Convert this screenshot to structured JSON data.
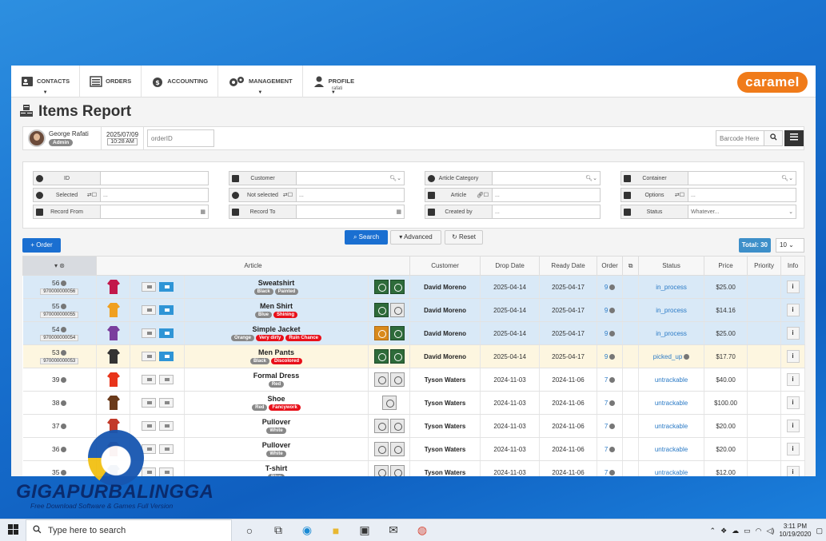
{
  "nav": {
    "items": [
      {
        "label": "CONTACTS",
        "icon": "contact-card-icon"
      },
      {
        "label": "ORDERS",
        "icon": "list-icon"
      },
      {
        "label": "ACCOUNTING",
        "icon": "money-bag-icon"
      },
      {
        "label": "MANAGEMENT",
        "icon": "gears-icon"
      },
      {
        "label": "PROFILE",
        "icon": "user-icon",
        "sub": "rafati"
      }
    ],
    "logo": "caramel"
  },
  "page": {
    "title": "Items Report"
  },
  "userbar": {
    "name": "George Rafati",
    "role": "Admin",
    "date": "2025/07/09",
    "time": "10:28 AM",
    "orderid_placeholder": "orderID",
    "barcode_placeholder": "Barcode Here"
  },
  "filters": {
    "id": "ID",
    "customer": "Customer",
    "article_category": "Article Category",
    "container": "Container",
    "selected": "Selected",
    "not_selected": "Not selected",
    "article": "Article",
    "options": "Options",
    "record_from": "Record From",
    "record_to": "Record To",
    "created_by": "Created by",
    "status": "Status",
    "status_value": "Whatever...",
    "search_hint": "..."
  },
  "actions": {
    "order": "Order",
    "search": "Search",
    "advanced": "Advanced",
    "reset": "Reset",
    "total": "Total: 30",
    "page_size": "10"
  },
  "table": {
    "headers": {
      "article": "Article",
      "customer": "Customer",
      "drop_date": "Drop Date",
      "ready_date": "Ready Date",
      "order": "Order",
      "status": "Status",
      "price": "Price",
      "priority": "Priority",
      "info": "Info"
    },
    "rows": [
      {
        "id": "56",
        "barcode": "970000000056",
        "name": "Sweatshirt",
        "tags": [
          {
            "t": "Black",
            "c": "gray"
          },
          {
            "t": "Painted",
            "c": "gray"
          }
        ],
        "customer": "David Moreno",
        "drop": "2025-04-14",
        "ready": "2025-04-17",
        "order": "9",
        "status": "in_process",
        "price": "$25.00",
        "state": "sel"
      },
      {
        "id": "55",
        "barcode": "970000000055",
        "name": "Men Shirt",
        "tags": [
          {
            "t": "Blue",
            "c": "gray"
          },
          {
            "t": "Shining",
            "c": "red"
          }
        ],
        "customer": "David Moreno",
        "drop": "2025-04-14",
        "ready": "2025-04-17",
        "order": "9",
        "status": "in_process",
        "price": "$14.16",
        "state": "sel"
      },
      {
        "id": "54",
        "barcode": "970000000054",
        "name": "Simple Jacket",
        "tags": [
          {
            "t": "Orange",
            "c": "gray"
          },
          {
            "t": "Very dirty",
            "c": "red"
          },
          {
            "t": "Ruin Chance",
            "c": "red"
          }
        ],
        "customer": "David Moreno",
        "drop": "2025-04-14",
        "ready": "2025-04-17",
        "order": "9",
        "status": "in_process",
        "price": "$25.00",
        "state": "sel"
      },
      {
        "id": "53",
        "barcode": "970000000053",
        "name": "Men Pants",
        "tags": [
          {
            "t": "Black",
            "c": "gray"
          },
          {
            "t": "Discolored",
            "c": "red"
          }
        ],
        "customer": "David Moreno",
        "drop": "2025-04-14",
        "ready": "2025-04-17",
        "order": "9",
        "status": "picked_up",
        "price": "$17.70",
        "state": "pick"
      },
      {
        "id": "39",
        "barcode": "",
        "name": "Formal Dress",
        "tags": [
          {
            "t": "Red",
            "c": "gray"
          }
        ],
        "customer": "Tyson Waters",
        "drop": "2024-11-03",
        "ready": "2024-11-06",
        "order": "7",
        "status": "untrackable",
        "price": "$40.00",
        "state": ""
      },
      {
        "id": "38",
        "barcode": "",
        "name": "Shoe",
        "tags": [
          {
            "t": "Red",
            "c": "gray"
          },
          {
            "t": "Fancywork",
            "c": "red"
          }
        ],
        "customer": "Tyson Waters",
        "drop": "2024-11-03",
        "ready": "2024-11-06",
        "order": "7",
        "status": "untrackable",
        "price": "$100.00",
        "state": ""
      },
      {
        "id": "37",
        "barcode": "",
        "name": "Pullover",
        "tags": [
          {
            "t": "White",
            "c": "gray"
          }
        ],
        "customer": "Tyson Waters",
        "drop": "2024-11-03",
        "ready": "2024-11-06",
        "order": "7",
        "status": "untrackable",
        "price": "$20.00",
        "state": ""
      },
      {
        "id": "36",
        "barcode": "",
        "name": "Pullover",
        "tags": [
          {
            "t": "White",
            "c": "gray"
          }
        ],
        "customer": "Tyson Waters",
        "drop": "2024-11-03",
        "ready": "2024-11-06",
        "order": "7",
        "status": "untrackable",
        "price": "$20.00",
        "state": ""
      },
      {
        "id": "35",
        "barcode": "",
        "name": "T-shirt",
        "tags": [
          {
            "t": "Blue",
            "c": "gray"
          }
        ],
        "customer": "Tyson Waters",
        "drop": "2024-11-03",
        "ready": "2024-11-06",
        "order": "7",
        "status": "untrackable",
        "price": "$12.00",
        "state": ""
      }
    ]
  },
  "taskbar": {
    "search_placeholder": "Type here to search",
    "time": "3:11 PM",
    "date": "10/19/2020"
  },
  "watermark": {
    "brand": "GIGAPURBALINGGA",
    "tagline": "Free Download Software & Games Full Version"
  },
  "colors": {
    "accent": "#1a6fd1",
    "logo": "#f07b1a",
    "selected_row": "#d9e9f7",
    "picked_row": "#fdf6e0",
    "danger_tag": "#e8101a"
  }
}
